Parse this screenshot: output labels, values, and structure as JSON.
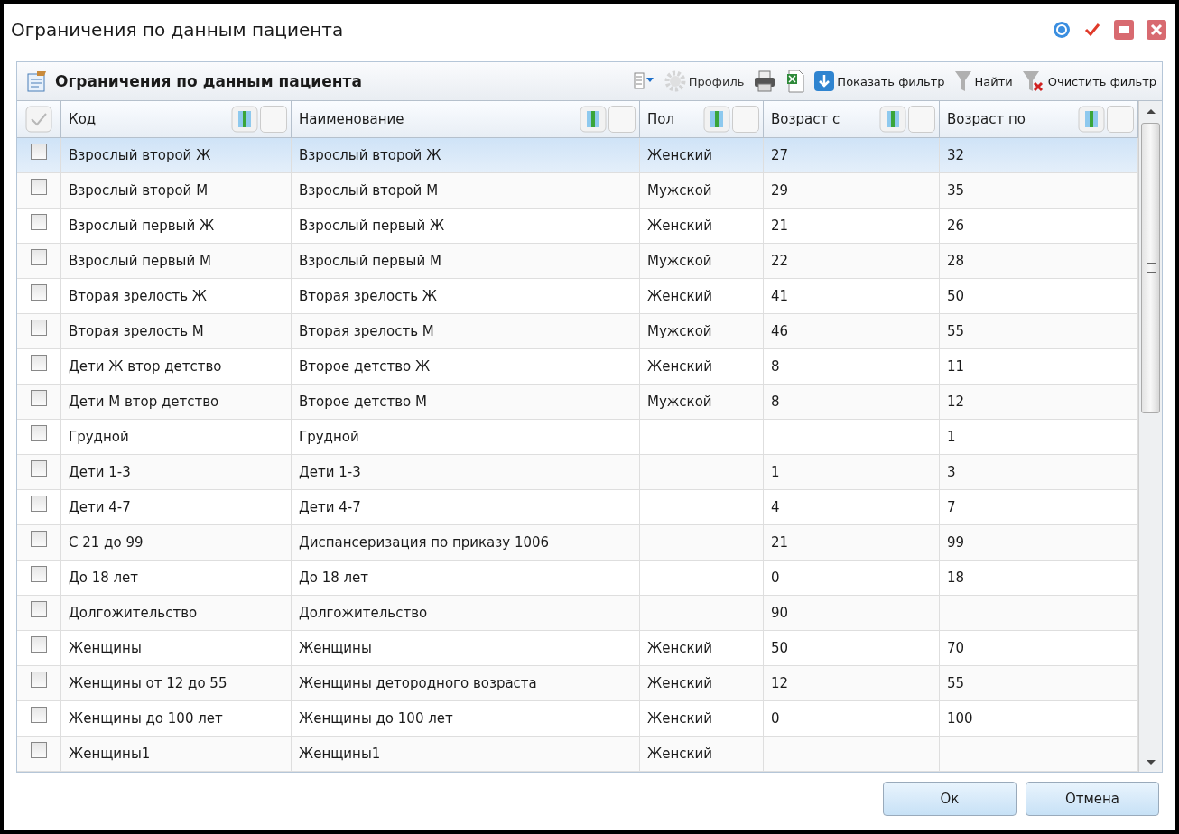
{
  "window": {
    "title": "Ограничения по данным пациента"
  },
  "panel": {
    "title": "Ограничения по данным пациента"
  },
  "toolbar": [
    {
      "kind": "columns"
    },
    {
      "kind": "gear",
      "label": "Профиль",
      "disabled": true
    },
    {
      "kind": "print"
    },
    {
      "kind": "excel"
    },
    {
      "kind": "down",
      "label": "Показать фильтр"
    },
    {
      "kind": "funnel",
      "label": "Найти"
    },
    {
      "kind": "clear",
      "label": "Очистить фильтр"
    }
  ],
  "select_all": {
    "checked": false
  },
  "columns": [
    "Код",
    "Наименование",
    "Пол",
    "Возраст с",
    "Возраст по"
  ],
  "rows": [
    {
      "selected": true,
      "checked": false,
      "cells": [
        "Взрослый второй Ж",
        "Взрослый второй Ж",
        "Женский",
        "27",
        "32"
      ]
    },
    {
      "selected": false,
      "checked": false,
      "cells": [
        "Взрослый второй М",
        "Взрослый второй М",
        "Мужской",
        "29",
        "35"
      ]
    },
    {
      "selected": false,
      "checked": false,
      "cells": [
        "Взрослый первый Ж",
        "Взрослый первый Ж",
        "Женский",
        "21",
        "26"
      ]
    },
    {
      "selected": false,
      "checked": false,
      "cells": [
        "Взрослый первый М",
        "Взрослый первый М",
        "Мужской",
        "22",
        "28"
      ]
    },
    {
      "selected": false,
      "checked": false,
      "cells": [
        "Вторая зрелость Ж",
        "Вторая зрелость Ж",
        "Женский",
        "41",
        "50"
      ]
    },
    {
      "selected": false,
      "checked": false,
      "cells": [
        "Вторая зрелость М",
        "Вторая зрелость М",
        "Мужской",
        "46",
        "55"
      ]
    },
    {
      "selected": false,
      "checked": false,
      "cells": [
        "Дети Ж втор детство",
        "Второе детство Ж",
        "Женский",
        "8",
        "11"
      ]
    },
    {
      "selected": false,
      "checked": false,
      "cells": [
        "Дети М втор детство",
        "Второе детство М",
        "Мужской",
        "8",
        "12"
      ]
    },
    {
      "selected": false,
      "checked": false,
      "cells": [
        "Грудной",
        "Грудной",
        null,
        null,
        "1"
      ]
    },
    {
      "selected": false,
      "checked": false,
      "cells": [
        "Дети 1-3",
        "Дети 1-3",
        null,
        "1",
        "3"
      ]
    },
    {
      "selected": false,
      "checked": false,
      "cells": [
        "Дети 4-7",
        "Дети 4-7",
        null,
        "4",
        "7"
      ]
    },
    {
      "selected": false,
      "checked": false,
      "cells": [
        "С 21 до 99",
        "Диспансеризация по приказу 1006",
        null,
        "21",
        "99"
      ]
    },
    {
      "selected": false,
      "checked": false,
      "cells": [
        "До 18 лет",
        "До 18 лет",
        null,
        "0",
        "18"
      ]
    },
    {
      "selected": false,
      "checked": false,
      "cells": [
        "Долгожительство",
        "Долгожительство",
        null,
        "90",
        null
      ]
    },
    {
      "selected": false,
      "checked": false,
      "cells": [
        "Женщины",
        "Женщины",
        "Женский",
        "50",
        "70"
      ]
    },
    {
      "selected": false,
      "checked": false,
      "cells": [
        "Женщины от 12 до 55",
        "Женщины детородного возраста",
        "Женский",
        "12",
        "55"
      ]
    },
    {
      "selected": false,
      "checked": false,
      "cells": [
        "Женщины до 100 лет",
        "Женщины до 100 лет",
        "Женский",
        "0",
        "100"
      ]
    },
    {
      "selected": false,
      "checked": false,
      "cells": [
        "Женщины1",
        "Женщины1",
        "Женский",
        null,
        null
      ]
    }
  ],
  "buttons": [
    "Ок",
    "Отмена"
  ]
}
